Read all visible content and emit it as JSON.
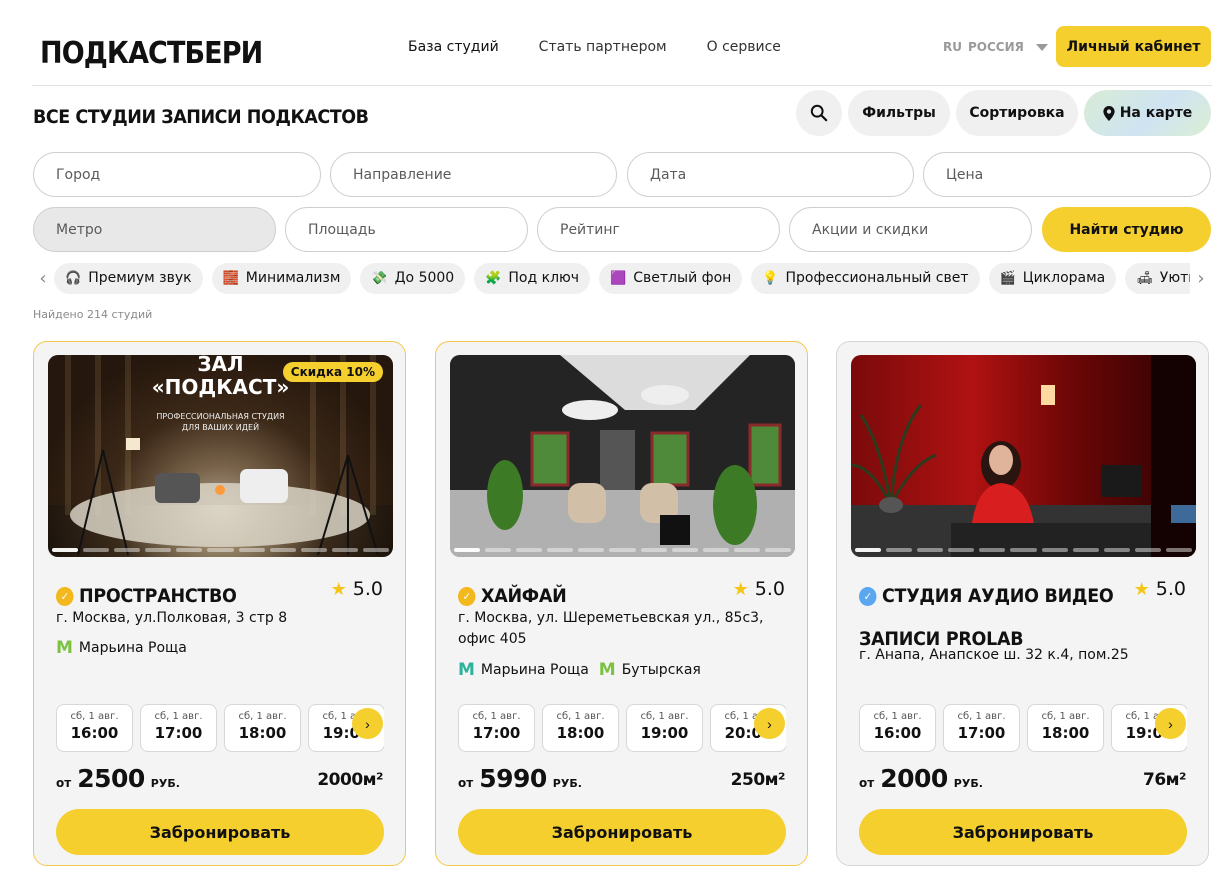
{
  "header": {
    "logo": "ПОДКАСТБЕРИ",
    "nav": [
      "База студий",
      "Стать партнером",
      "О сервисе"
    ],
    "region_code": "RU",
    "region": "РОССИЯ",
    "cabinet": "Личный кабинет"
  },
  "title": "ВСЕ СТУДИИ ЗАПИСИ ПОДКАСТОВ",
  "actions": {
    "filters": "Фильтры",
    "sort": "Сортировка",
    "map": "На карте"
  },
  "filters": {
    "city": "Город",
    "direction": "Направление",
    "date": "Дата",
    "price": "Цена",
    "metro": "Метро",
    "area": "Площадь",
    "rating": "Рейтинг",
    "promo": "Акции и скидки",
    "find": "Найти студию"
  },
  "chips": [
    {
      "icon": "🎧",
      "label": "Премиум звук"
    },
    {
      "icon": "🧱",
      "label": "Минимализм"
    },
    {
      "icon": "💸",
      "label": "До 5000"
    },
    {
      "icon": "🧩",
      "label": "Под ключ"
    },
    {
      "icon": "🟪",
      "label": "Светлый фон"
    },
    {
      "icon": "💡",
      "label": "Профессиональный свет"
    },
    {
      "icon": "🎬",
      "label": "Циклорама"
    },
    {
      "icon": "🛋",
      "label": "Уютная атмосфера"
    },
    {
      "icon": "🎙",
      "label": ""
    }
  ],
  "found": "Найдено 214 студий",
  "cards": [
    {
      "title": "ПРОСТРАНСТВО",
      "rating": "5.0",
      "address": "г. Москва, ул.Полковая, 3 стр 8",
      "metro": [
        "Марьина Роща"
      ],
      "badge": "Скидка 10%",
      "slots": [
        {
          "d": "сб, 1 авг.",
          "t": "16:00"
        },
        {
          "d": "сб, 1 авг.",
          "t": "17:00"
        },
        {
          "d": "сб, 1 авг.",
          "t": "18:00"
        },
        {
          "d": "сб, 1 авг.",
          "t": "19:00"
        }
      ],
      "price_from": "от",
      "price": "2500",
      "currency": "РУБ.",
      "area": "2000м²",
      "book": "Забронировать",
      "image": {
        "headline": "ЗАЛ «ПОДКАСТ»",
        "sub1": "ПРОФЕССИОНАЛЬНАЯ СТУДИЯ",
        "sub2": "ДЛЯ ВАШИХ ИДЕЙ"
      }
    },
    {
      "title": "ХАЙФАЙ",
      "rating": "5.0",
      "address": "г. Москва, ул. Шереметьевская ул., 85с3, офис 405",
      "metro": [
        "Марьина Роща",
        "Бутырская"
      ],
      "slots": [
        {
          "d": "сб, 1 авг.",
          "t": "17:00"
        },
        {
          "d": "сб, 1 авг.",
          "t": "18:00"
        },
        {
          "d": "сб, 1 авг.",
          "t": "19:00"
        },
        {
          "d": "сб, 1 авг.",
          "t": "20:00"
        }
      ],
      "price_from": "от",
      "price": "5990",
      "currency": "РУБ.",
      "area": "250м²",
      "book": "Забронировать"
    },
    {
      "title_line1": "СТУДИЯ АУДИО ВИДЕО",
      "title_line2": "ЗАПИСИ PROLAB",
      "rating": "5.0",
      "address": "г. Анапа, Анапское ш. 32 к.4, пом.25",
      "slots": [
        {
          "d": "сб, 1 авг.",
          "t": "16:00"
        },
        {
          "d": "сб, 1 авг.",
          "t": "17:00"
        },
        {
          "d": "сб, 1 авг.",
          "t": "18:00"
        },
        {
          "d": "сб, 1 авг.",
          "t": "19:00"
        }
      ],
      "price_from": "от",
      "price": "2000",
      "currency": "РУБ.",
      "area": "76м²",
      "book": "Забронировать"
    }
  ],
  "colors": {
    "accent": "#f5cf2e",
    "verified_gold": "#f2b81c",
    "verified_blue": "#5aa7f0",
    "metro_green": "#7cc242",
    "metro_teal": "#2db39c"
  }
}
